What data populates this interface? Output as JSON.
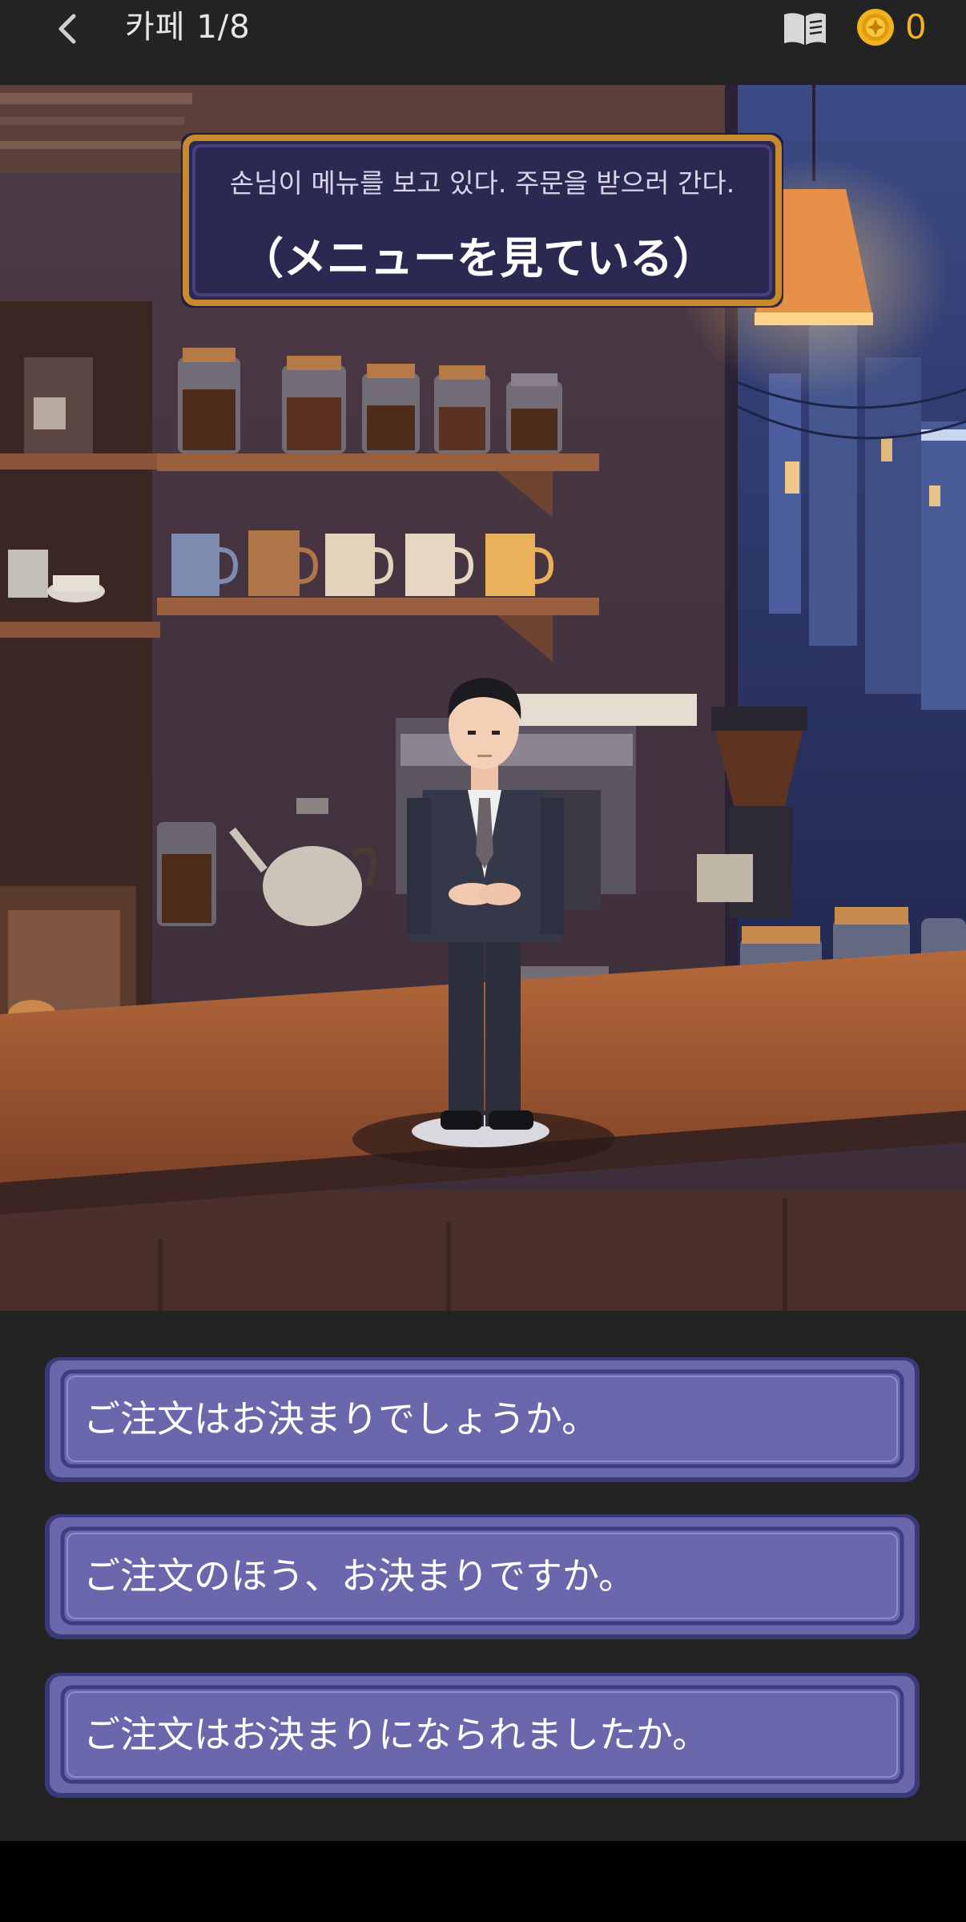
{
  "header": {
    "title": "카페  1/8",
    "coins": "0",
    "back_icon": "chevron-left-icon",
    "book_icon": "book-icon",
    "coin_icon": "coin-icon"
  },
  "scene": {
    "narration": "손님이 메뉴를 보고 있다. 주문을 받으러 간다.",
    "dialogue": "（メニューを見ている）",
    "setting": "pixel-art-cafe-counter",
    "character": "waiter-in-suit"
  },
  "choices": [
    {
      "label": "ご注文はお決まりでしょうか。"
    },
    {
      "label": "ご注文のほう、お決まりですか。"
    },
    {
      "label": "ご注文はお決まりになられましたか。"
    }
  ],
  "colors": {
    "topbar_bg": "#232323",
    "coin_accent": "#f2b21e",
    "choice_fill": "#6a67ad",
    "banner_fill": "#2b2852",
    "banner_border": "#c98a2e"
  }
}
